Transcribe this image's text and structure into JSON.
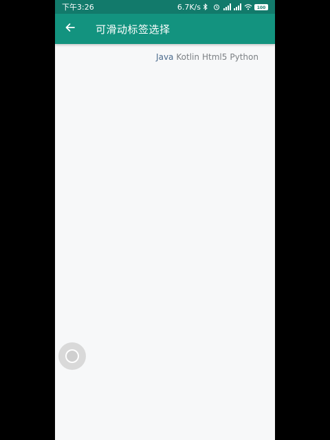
{
  "status_bar": {
    "time": "下午3:26",
    "net_speed": "6.7K/s",
    "battery_level": "100",
    "icons": [
      "bluetooth-icon",
      "alarm-icon",
      "signal-icon",
      "signal-icon",
      "wifi-icon",
      "battery-icon"
    ]
  },
  "toolbar": {
    "title": "可滑动标签选择",
    "back_icon": "arrow-left-icon"
  },
  "tabs": [
    {
      "label": "Java",
      "selected": true
    },
    {
      "label": "Kotlin",
      "selected": false
    },
    {
      "label": "Html5",
      "selected": false
    },
    {
      "label": "Python",
      "selected": false
    }
  ],
  "colors": {
    "toolbar": "#13937f",
    "status_bar": "#127a6b",
    "tab_selected": "#4a6a8c",
    "tab_normal": "#7b7f83",
    "background": "#f7f8f9"
  },
  "float_ball_icon": "assistive-touch-icon"
}
